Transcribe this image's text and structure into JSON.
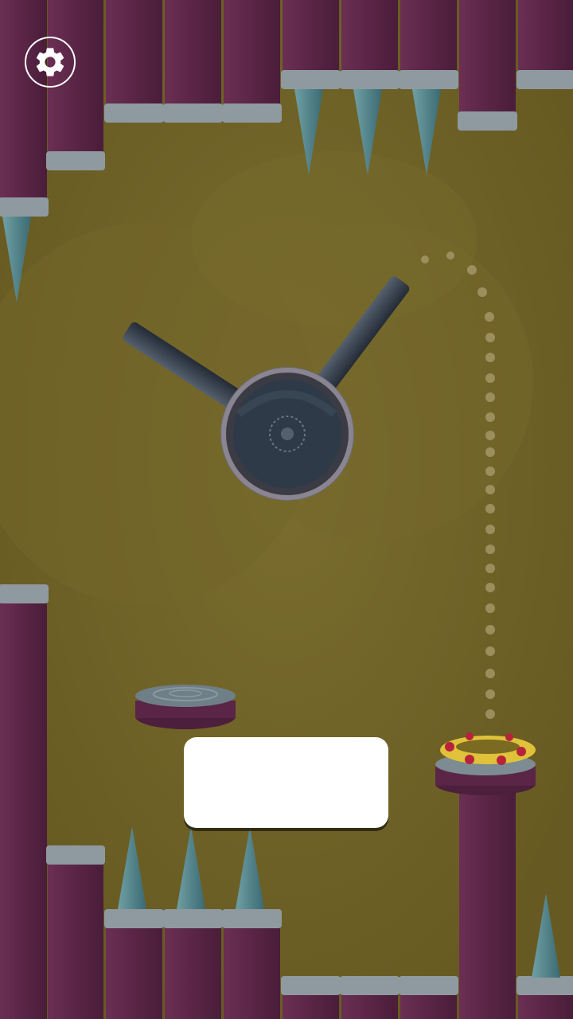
{
  "game": {
    "background_color": "#6e6126",
    "pillar_color": "#5e2848",
    "pillar_cap_color": "#8f9aa0",
    "spike_color": "#4f7f86",
    "cannon_color": "#2f3a48",
    "ring_colors": [
      "#e0c23a",
      "#b8233b"
    ]
  },
  "settings_button": {
    "icon": "gear-icon"
  },
  "popup": {
    "text": ""
  }
}
